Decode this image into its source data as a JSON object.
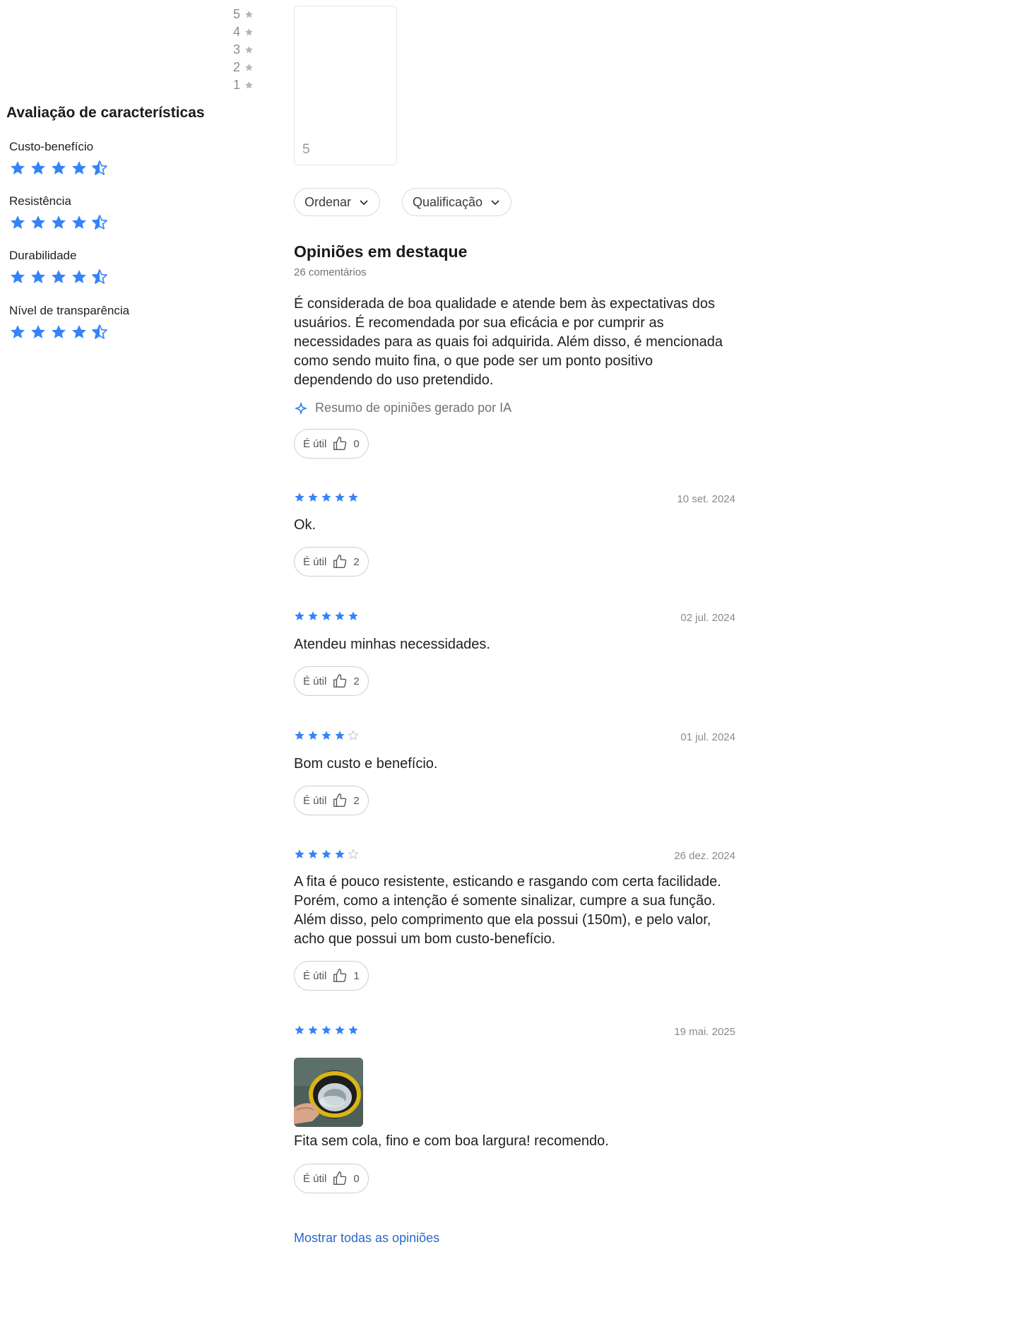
{
  "histogram": {
    "rows": [
      {
        "label": "5"
      },
      {
        "label": "4"
      },
      {
        "label": "3"
      },
      {
        "label": "2"
      },
      {
        "label": "1"
      }
    ],
    "box_label": "5"
  },
  "characteristics": {
    "title": "Avaliação de características",
    "items": [
      {
        "label": "Custo-benefício",
        "rating": 4.5
      },
      {
        "label": "Resistência",
        "rating": 4.5
      },
      {
        "label": "Durabilidade",
        "rating": 4.5
      },
      {
        "label": "Nível de transparência",
        "rating": 4.5
      }
    ]
  },
  "filters": {
    "sort_label": "Ordenar",
    "rating_label": "Qualificação"
  },
  "highlights": {
    "title": "Opiniões em destaque",
    "count": "26 comentários",
    "summary": "É considerada de boa qualidade e atende bem às expectativas dos usuários. É recomendada por sua eficácia e por cumprir as necessidades para as quais foi adquirida. Além disso, é mencionada como sendo muito fina, o que pode ser um ponto positivo dependendo do uso pretendido.",
    "ai_note": "Resumo de opiniões gerado por IA",
    "useful_label": "É útil",
    "useful_count": "0"
  },
  "reviews": [
    {
      "stars": 5,
      "date": "10 set. 2024",
      "text": "Ok.",
      "useful_label": "É útil",
      "useful_count": "2"
    },
    {
      "stars": 5,
      "date": "02 jul. 2024",
      "text": "Atendeu minhas necessidades.",
      "useful_label": "É útil",
      "useful_count": "2"
    },
    {
      "stars": 4,
      "date": "01 jul. 2024",
      "text": "Bom custo e benefício.",
      "useful_label": "É útil",
      "useful_count": "2"
    },
    {
      "stars": 4,
      "date": "26 dez. 2024",
      "text": "A fita é pouco resistente, esticando e rasgando com certa facilidade. Porém, como a intenção é somente sinalizar, cumpre a sua função. Além disso, pelo comprimento que ela possui (150m), e pelo valor, acho que possui um bom custo-benefício.",
      "useful_label": "É útil",
      "useful_count": "1"
    },
    {
      "stars": 5,
      "date": "19 mai. 2025",
      "text": "Fita sem cola, fino e com boa largura! recomendo.",
      "useful_label": "É útil",
      "useful_count": "0"
    }
  ],
  "show_all": "Mostrar todas as opiniões",
  "colors": {
    "star": "#3483fa",
    "star_empty": "#c7c7c7",
    "link": "#2968c8"
  }
}
